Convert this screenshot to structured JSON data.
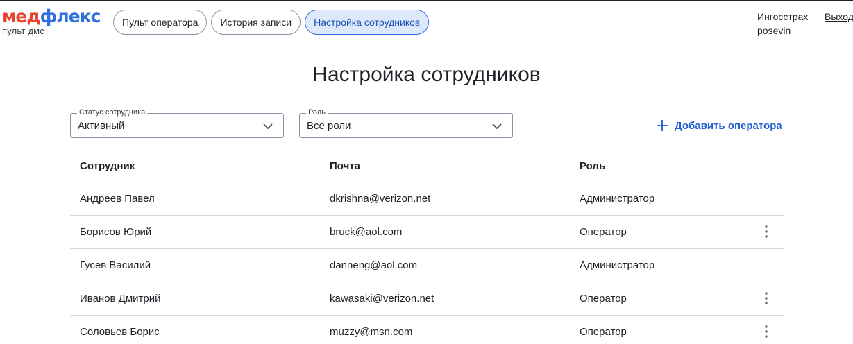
{
  "logo": {
    "part1": "мед",
    "part2": "флекс",
    "subtitle": "пульт дмс"
  },
  "nav": [
    {
      "label": "Пульт оператора",
      "active": false
    },
    {
      "label": "История записи",
      "active": false
    },
    {
      "label": "Настройка сотрудников",
      "active": true
    }
  ],
  "user": {
    "company": "Ингосстрах",
    "login": "posevin"
  },
  "logout_label": "Выход",
  "page_title": "Настройка сотрудников",
  "filters": {
    "status": {
      "label": "Статус сотрудника",
      "value": "Активный"
    },
    "role": {
      "label": "Роль",
      "value": "Все роли"
    }
  },
  "add_operator_label": "Добавить оператора",
  "table": {
    "headers": [
      "Сотрудник",
      "Почта",
      "Роль"
    ],
    "rows": [
      {
        "name": "Андреев Павел",
        "email": "dkrishna@verizon.net",
        "role": "Администратор",
        "menu": false
      },
      {
        "name": "Борисов Юрий",
        "email": "bruck@aol.com",
        "role": "Оператор",
        "menu": true
      },
      {
        "name": "Гусев Василий",
        "email": "danneng@aol.com",
        "role": "Администратор",
        "menu": false
      },
      {
        "name": "Иванов Дмитрий",
        "email": "kawasaki@verizon.net",
        "role": "Оператор",
        "menu": true
      },
      {
        "name": "Соловьев Борис",
        "email": "muzzy@msn.com",
        "role": "Оператор",
        "menu": true
      }
    ]
  },
  "colors": {
    "brand_red": "#e8432e",
    "brand_blue": "#2f6fe0",
    "link_blue": "#1f5fd1",
    "active_pill_bg": "#dde8fb"
  }
}
